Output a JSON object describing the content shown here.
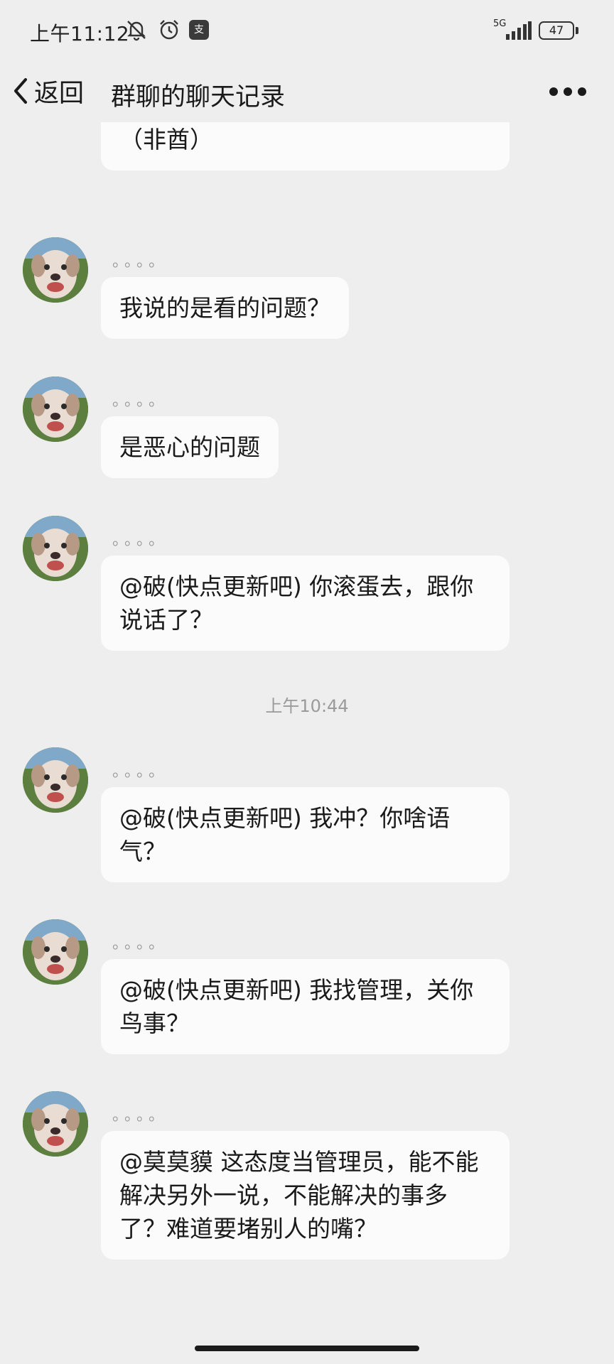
{
  "status_bar": {
    "time": "上午11:12",
    "app_badge": "支",
    "network": "5G",
    "battery": "47"
  },
  "nav": {
    "back_label": "返回",
    "title": "群聊的聊天记录"
  },
  "messages": [
    {
      "nick": "",
      "text": "嗜猪 @莫莫貘 @胖胖鱼 @涩涩狗（非酋）"
    },
    {
      "nick": "。。。。",
      "text": "我说的是看的问题？"
    },
    {
      "nick": "。。。。",
      "text": "是恶心的问题"
    },
    {
      "nick": "。。。。",
      "text": "@破(快点更新吧) 你滚蛋去，跟你说话了？"
    },
    {
      "nick": "。。。。",
      "text": "@破(快点更新吧) 我冲？你啥语气？"
    },
    {
      "nick": "。。。。",
      "text": "@破(快点更新吧) 我找管理，关你鸟事？"
    },
    {
      "nick": "。。。。",
      "text": "@莫莫貘 这态度当管理员，能不能解决另外一说，不能解决的事多了？难道要堵别人的嘴？"
    }
  ],
  "time_divider": "上午10:44",
  "icons": {
    "back": "chevron-left-icon",
    "more": "more-icon",
    "mute": "bell-off-icon",
    "alarm": "alarm-icon",
    "signal": "signal-icon",
    "battery": "battery-icon"
  }
}
